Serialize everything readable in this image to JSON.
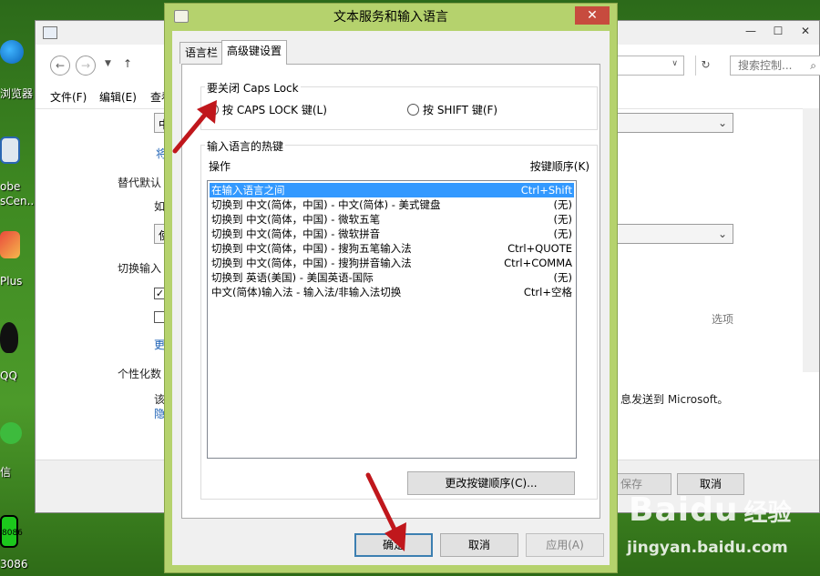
{
  "desktop": {
    "items": [
      {
        "label": "浏览器"
      },
      {
        "label": "obe"
      },
      {
        "label": "sCen..."
      },
      {
        "label": "Plus"
      },
      {
        "label": "QQ"
      },
      {
        "label": "信"
      },
      {
        "label": "8086"
      },
      {
        "label": "3086"
      }
    ]
  },
  "background_window": {
    "menu": [
      "文件(F)",
      "编辑(E)",
      "查看"
    ],
    "search_placeholder": "搜索控制...",
    "texts": {
      "replace_default": "替代默认",
      "switch_input": "切换输入",
      "personalize": "个性化数",
      "options_link": "选项",
      "send_microsoft": "息发送到 Microsoft。",
      "link_1": "将",
      "link_2": "更",
      "link_3": "隐",
      "small_1": "如",
      "small_2": "该",
      "select_prefix_1": "中",
      "select_prefix_2": "使"
    },
    "buttons": {
      "save": "保存",
      "cancel": "取消"
    }
  },
  "dialog": {
    "title": "文本服务和输入语言",
    "close": "✕",
    "tabs": [
      "语言栏",
      "高级键设置"
    ],
    "active_tab_index": 1,
    "caps_group": {
      "label": "要关闭 Caps Lock",
      "options": [
        {
          "label": "按 CAPS LOCK 键(L)",
          "selected": true
        },
        {
          "label": "按 SHIFT 键(F)",
          "selected": false
        }
      ]
    },
    "hotkeys_group": {
      "label": "输入语言的热键",
      "col_action": "操作",
      "col_sequence": "按键顺序(K)",
      "rows": [
        {
          "action": "在输入语言之间",
          "keys": "Ctrl+Shift",
          "selected": true
        },
        {
          "action": "切换到 中文(简体，中国) - 中文(简体) - 美式键盘",
          "keys": "(无)"
        },
        {
          "action": "切换到 中文(简体，中国) - 微软五笔",
          "keys": "(无)"
        },
        {
          "action": "切换到 中文(简体，中国) - 微软拼音",
          "keys": "(无)"
        },
        {
          "action": "切换到 中文(简体，中国) - 搜狗五笔输入法",
          "keys": "Ctrl+QUOTE"
        },
        {
          "action": "切换到 中文(简体，中国) - 搜狗拼音输入法",
          "keys": "Ctrl+COMMA"
        },
        {
          "action": "切换到 英语(美国) - 美国英语-国际",
          "keys": "(无)"
        },
        {
          "action": "中文(简体)输入法 - 输入法/非输入法切换",
          "keys": "Ctrl+空格"
        }
      ],
      "change_button": "更改按键顺序(C)..."
    },
    "footer": {
      "ok": "确定",
      "cancel": "取消",
      "apply": "应用(A)"
    }
  },
  "watermark": {
    "brand": "Baidu",
    "cn": "经验",
    "url": "jingyan.baidu.com"
  },
  "colors": {
    "dialog_frame": "#b5d26d",
    "close_button": "#c74b3e",
    "selection": "#3399ff",
    "annotation_arrow": "#c0171c"
  }
}
